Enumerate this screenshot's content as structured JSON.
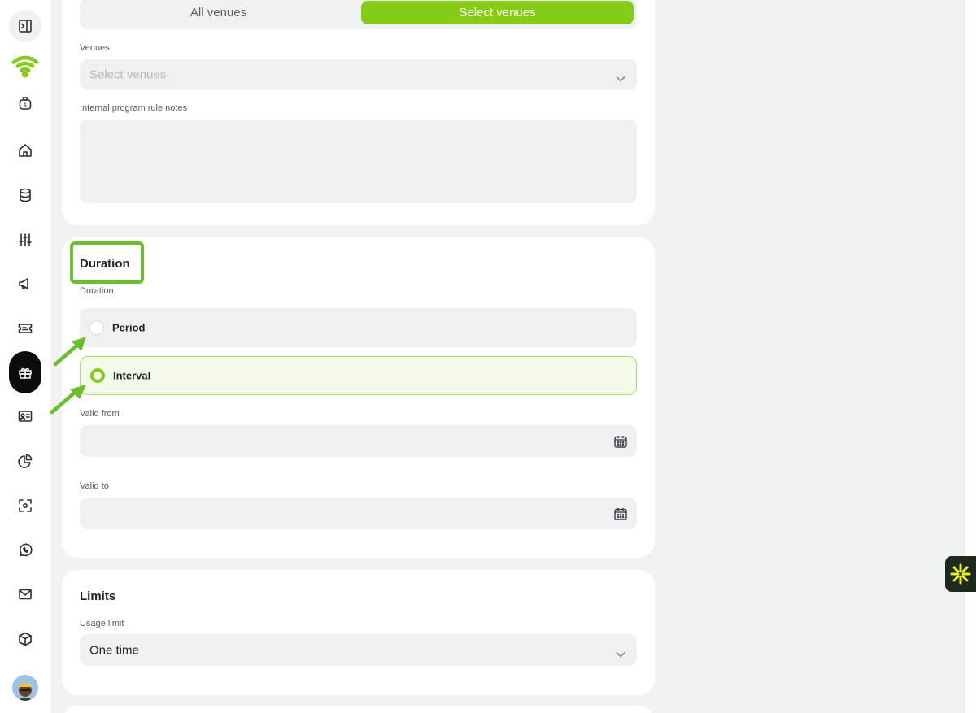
{
  "sidebar": {
    "items": [
      {
        "icon": "panel-toggle-icon"
      },
      {
        "icon": "wifi-logo-icon",
        "color": "#84cc16"
      },
      {
        "icon": "money-bag-icon"
      },
      {
        "icon": "home-icon"
      },
      {
        "icon": "database-icon"
      },
      {
        "icon": "sliders-icon"
      },
      {
        "icon": "megaphone-icon"
      },
      {
        "icon": "ticket-icon"
      },
      {
        "icon": "gift-icon",
        "active": true
      },
      {
        "icon": "id-card-icon"
      },
      {
        "icon": "pie-chart-icon"
      },
      {
        "icon": "scan-icon"
      },
      {
        "icon": "whatsapp-icon"
      },
      {
        "icon": "mail-icon"
      },
      {
        "icon": "box-icon"
      },
      {
        "icon": "avatar"
      }
    ]
  },
  "venues_card": {
    "segment": {
      "all_label": "All venues",
      "select_label": "Select venues",
      "selected": "Select venues"
    },
    "venues_label": "Venues",
    "venues_placeholder": "Select venues",
    "notes_label": "Internal program rule notes",
    "notes_value": ""
  },
  "duration_card": {
    "title": "Duration",
    "field_label": "Duration",
    "options": [
      {
        "label": "Period",
        "selected": false
      },
      {
        "label": "Interval",
        "selected": true
      }
    ],
    "valid_from_label": "Valid from",
    "valid_from_value": "",
    "valid_to_label": "Valid to",
    "valid_to_value": ""
  },
  "limits_card": {
    "title": "Limits",
    "usage_limit_label": "Usage limit",
    "usage_limit_value": "One time"
  },
  "colors": {
    "accent": "#84cc16",
    "annotation": "#6abf2d",
    "fab_bg": "#1f2a1c",
    "fab_icon": "#e6f227"
  },
  "fab": {
    "icon": "asterisk-burst-icon"
  }
}
